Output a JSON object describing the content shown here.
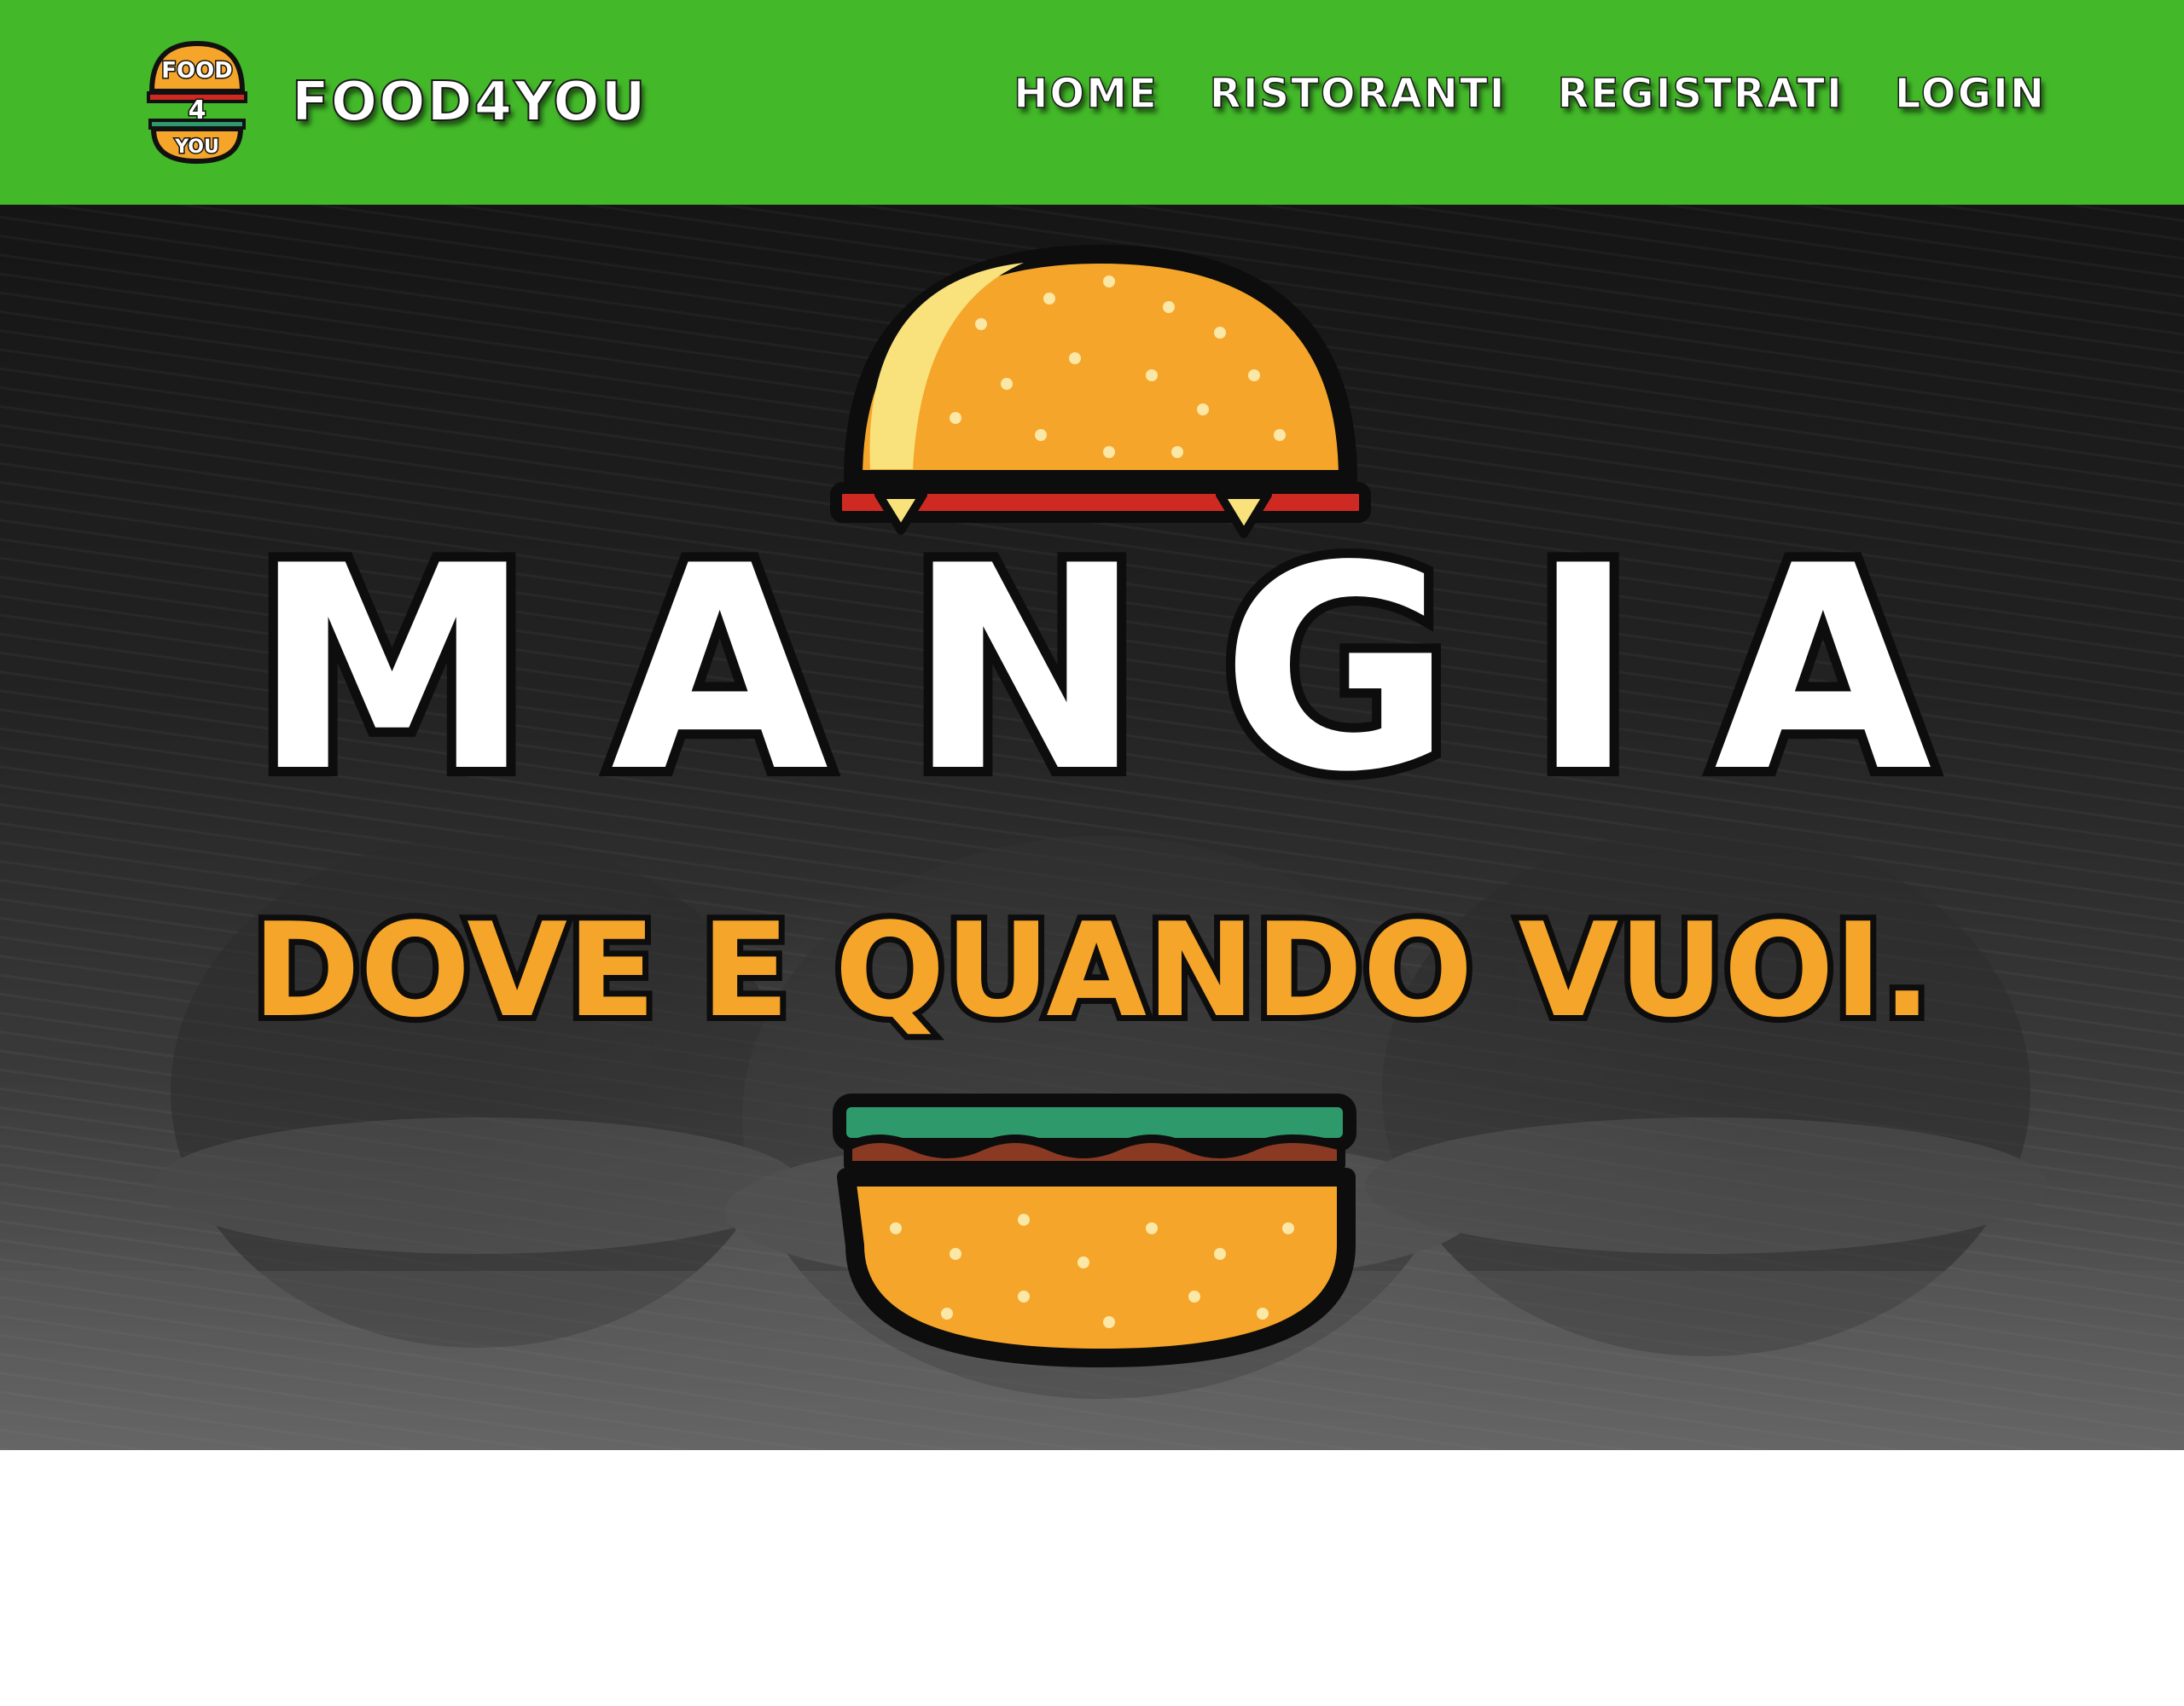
{
  "navbar": {
    "brand_logo": {
      "line1": "FOOD",
      "line2": "4",
      "line3": "YOU"
    },
    "brand_name": "FOOD4YOU",
    "links": [
      "HOME",
      "RISTORANTI",
      "REGISTRATI",
      "LOGIN"
    ],
    "background_color": "#43b929"
  },
  "hero": {
    "title": "MANGIA",
    "tagline": "DOVE E QUANDO VUOI.",
    "tagline_color": "#f5a52a",
    "bun_color": "#f5a52a",
    "lettuce_color": "#2e9a6b",
    "sauce_color": "#cf2a22"
  }
}
